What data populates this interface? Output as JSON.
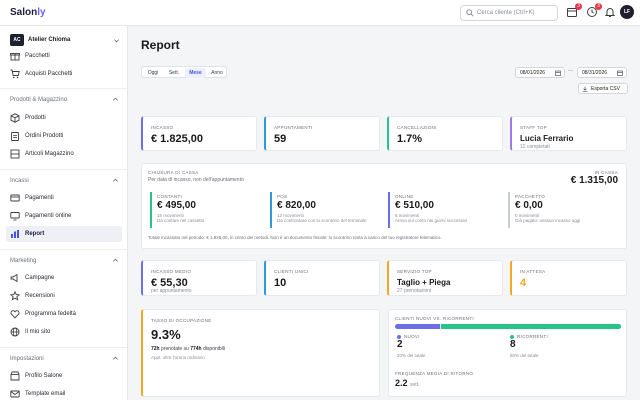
{
  "app": {
    "logo_main": "Salon",
    "logo_accent": "ly"
  },
  "topbar": {
    "search_placeholder": "Cerca cliente (Ctrl+K)",
    "badges": [
      "3",
      "3"
    ],
    "avatar": "LF"
  },
  "sidebar": {
    "workspace": {
      "initials": "AC",
      "name": "Atelier Chioma"
    },
    "top_items": [
      {
        "label": "Pacchetti",
        "icon": "gift-icon"
      },
      {
        "label": "Acquisti Pacchetti",
        "icon": "cart-icon"
      }
    ],
    "sections": [
      {
        "title": "Prodotti & Magazzino",
        "items": [
          {
            "label": "Prodotti",
            "icon": "box-icon"
          },
          {
            "label": "Ordini Prodotti",
            "icon": "clipboard-icon"
          },
          {
            "label": "Articoli Magazzino",
            "icon": "shelf-icon"
          }
        ]
      },
      {
        "title": "Incassi",
        "items": [
          {
            "label": "Pagamenti",
            "icon": "card-icon"
          },
          {
            "label": "Pagamenti online",
            "icon": "monitor-icon"
          },
          {
            "label": "Report",
            "icon": "bar-chart-icon"
          }
        ]
      },
      {
        "title": "Marketing",
        "items": [
          {
            "label": "Campagne",
            "icon": "megaphone-icon"
          },
          {
            "label": "Recensioni",
            "icon": "star-icon"
          },
          {
            "label": "Programma fedeltà",
            "icon": "heart-icon"
          },
          {
            "label": "Il mio sito",
            "icon": "globe-icon"
          }
        ]
      },
      {
        "title": "Impostazioni",
        "items": [
          {
            "label": "Profilo Salone",
            "icon": "store-icon"
          },
          {
            "label": "Template email",
            "icon": "mail-icon"
          }
        ]
      }
    ]
  },
  "page": {
    "title": "Report",
    "periods": [
      "Oggi",
      "Sett.",
      "Mese",
      "Anno"
    ],
    "selected_period": "Mese",
    "date_from": "08/01/2026",
    "date_to": "08/31/2026",
    "date_sep": "—",
    "export_label": "Esporta CSV"
  },
  "kpis_row1": [
    {
      "label": "INCASSO",
      "value": "€ 1.825,00",
      "sub": "",
      "color": "#6a6ee8"
    },
    {
      "label": "APPUNTAMENTI",
      "value": "59",
      "sub": "",
      "color": "#2d9cdb"
    },
    {
      "label": "CANCELLAZIONI",
      "value": "1.7%",
      "sub": "",
      "color": "#27c48a"
    },
    {
      "label": "STAFF TOP",
      "value": "Lucia Ferrario",
      "sub": "12 completati",
      "color": "#9b7be8"
    }
  ],
  "cash": {
    "title": "CHIUSURA DI CASSA",
    "desc": "Per data di incasso, non dell'appuntamento",
    "total_label": "IN CASSA",
    "total": "€ 1.315,00",
    "items": [
      {
        "label": "CONTANTI",
        "value": "€ 495,00",
        "s1": "15 movimenti",
        "s2": "Da contare nel cassetto",
        "color": "#27c48a"
      },
      {
        "label": "POS",
        "value": "€ 820,00",
        "s1": "12 movimenti",
        "s2": "Da confrontare con lo scontrino del terminale",
        "color": "#2d9cdb"
      },
      {
        "label": "ONLINE",
        "value": "€ 510,00",
        "s1": "8 movimenti",
        "s2": "Arriva sul conto nei giorni successivi",
        "color": "#6a6ee8"
      },
      {
        "label": "PACCHETTO",
        "value": "€ 0,00",
        "s1": "0 movimenti",
        "s2": "Già pagato: nessun incasso oggi",
        "color": "#c9ccd3"
      }
    ],
    "note": "Totale incassato nel periodo: € 1.825,00, in cento dei metodi. Non è un documento fiscale: lo scontrino resta a carico del tuo registratore telematico."
  },
  "kpis_row2": [
    {
      "label": "INCASSO MEDIO",
      "value": "€ 55,30",
      "sub": "per appuntamento",
      "color": "#6a6ee8"
    },
    {
      "label": "CLIENTI UNICI",
      "value": "10",
      "sub": "",
      "color": "#2d9cdb"
    },
    {
      "label": "SERVIZIO TOP",
      "value": "Taglio + Piega",
      "sub": "27 prenotazioni",
      "color": "#f5a623"
    },
    {
      "label": "IN ATTESA",
      "value": "4",
      "sub": "",
      "color": "#f5a623"
    }
  ],
  "occupancy": {
    "label": "TASSO DI OCCUPAZIONE",
    "value": "9.3%",
    "booked": "72h",
    "booked_text": "prenotate su",
    "available": "774h",
    "available_text": "disponibili",
    "note": "Appt. oltre l'orario ordinario",
    "color": "#f5a623"
  },
  "new_returning": {
    "label": "CLIENTI NUOVI VS. RICORRENTI",
    "new_fraction": 0.2,
    "new": {
      "label": "NUOVI",
      "value": "2",
      "pct": "20% del totale",
      "color": "#6a6ee8"
    },
    "returning": {
      "label": "RICORRENTI",
      "value": "8",
      "pct": "80% del totale",
      "color": "#27c48a"
    },
    "freq_label": "FREQUENZA MEDIA DI RITORNO",
    "freq_value": "2.2",
    "freq_unit": "sett."
  }
}
